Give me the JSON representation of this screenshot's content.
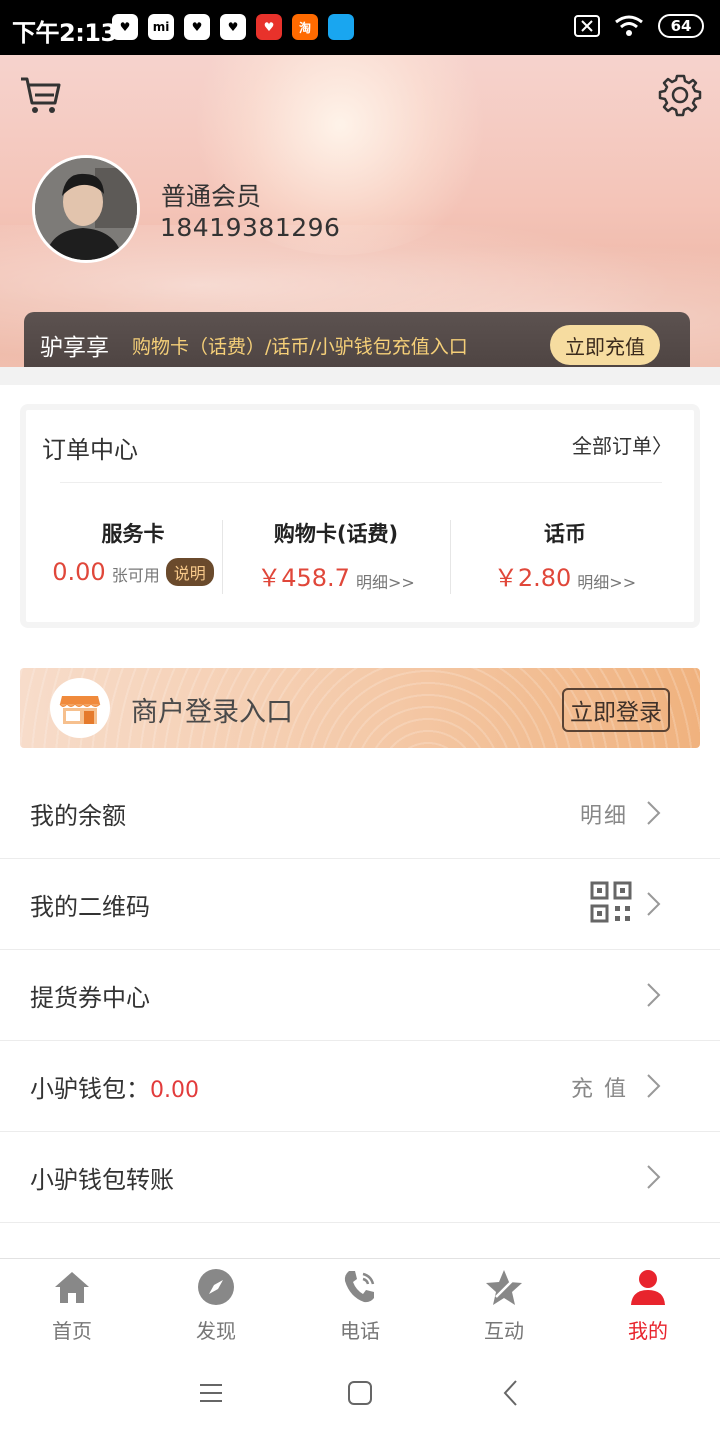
{
  "status_bar": {
    "time": "下午2:13",
    "notifications": [
      "heart-app",
      "mi",
      "heart-app",
      "heart-app",
      "red-app",
      "taobao",
      "blue-app"
    ],
    "notif_labels": [
      "♥",
      "mi",
      "♥",
      "♥",
      "♥",
      "淘",
      ""
    ],
    "battery": "64"
  },
  "profile": {
    "level": "普通会员",
    "phone": "18419381296"
  },
  "vip_bar": {
    "title": "驴享享",
    "description": "购物卡（话费）/话币/小驴钱包充值入口",
    "button": "立即充值"
  },
  "order_center": {
    "title": "订单中心",
    "all_orders": "全部订单〉",
    "stats": [
      {
        "label": "服务卡",
        "value": "0.00",
        "unit": "张可用",
        "badge": "说明"
      },
      {
        "label": "购物卡(话费)",
        "value": "￥458.7",
        "unit": "明细>>"
      },
      {
        "label": "话币",
        "value": "￥2.80",
        "unit": "明细>>"
      }
    ]
  },
  "merchant": {
    "text": "商户登录入口",
    "button": "立即登录"
  },
  "menu": [
    {
      "label": "我的余额",
      "right": "明细"
    },
    {
      "label": "我的二维码",
      "right": ""
    },
    {
      "label": "提货券中心",
      "right": ""
    },
    {
      "label": "小驴钱包：",
      "value": "0.00",
      "right": "充 值"
    },
    {
      "label": "小驴钱包转账",
      "right": ""
    }
  ],
  "tabs": [
    {
      "label": "首页",
      "icon": "home-icon"
    },
    {
      "label": "发现",
      "icon": "compass-icon"
    },
    {
      "label": "电话",
      "icon": "phone-icon"
    },
    {
      "label": "互动",
      "icon": "star-icon"
    },
    {
      "label": "我的",
      "icon": "person-icon",
      "active": true
    }
  ],
  "colors": {
    "accent_red": "#e8242d",
    "gold": "#f5cf78"
  }
}
